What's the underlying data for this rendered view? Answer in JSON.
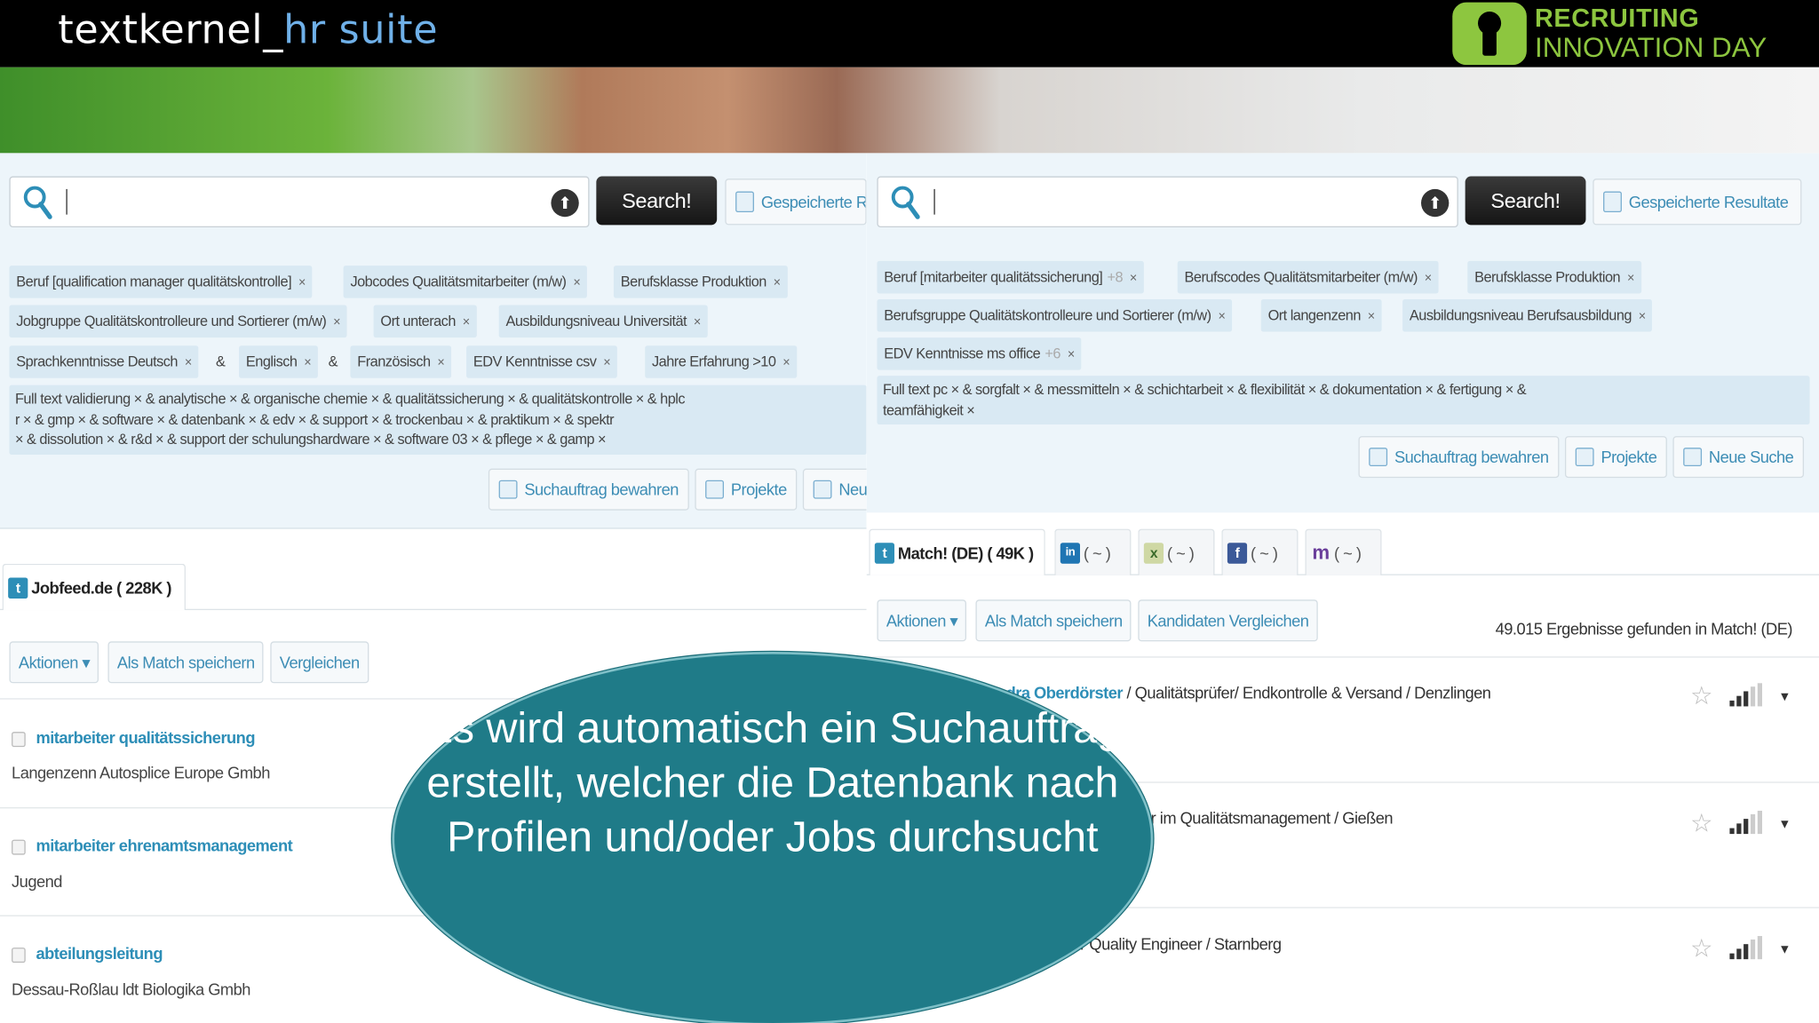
{
  "header": {
    "brand_main": "textkernel_",
    "brand_accent": "hr suite",
    "logo_line1": "RECRUITING",
    "logo_line2": "INNOVATION DAY"
  },
  "left": {
    "search_button": "Search!",
    "saved_button": "Gespeicherte R",
    "tags": [
      {
        "label": "Beruf  [qualification manager qualitätskontrolle]"
      },
      {
        "label": "Jobcodes  Qualitätsmitarbeiter (m/w)"
      },
      {
        "label": "Berufsklasse  Produktion"
      },
      {
        "label": "Jobgruppe  Qualitätskontrolleure und Sortierer (m/w)"
      },
      {
        "label": "Ort  unterach"
      },
      {
        "label": "Ausbildungsniveau  Universität"
      },
      {
        "label": "Sprachkenntnisse  Deutsch"
      },
      {
        "label": "Englisch"
      },
      {
        "label": "Französisch"
      },
      {
        "label": "EDV Kenntnisse  csv"
      },
      {
        "label": "Jahre Erfahrung  >10"
      }
    ],
    "amp": "&",
    "fulltext_line1": "Full text  validierung ×  &  analytische ×  &  organische chemie ×  &  qualitätssicherung ×  &  qualitätskontrolle ×  &  hplc",
    "fulltext_line2": "r ×  &  gmp ×  &  software ×  &  datenbank ×  &  edv ×  &  support ×  &  trockenbau ×  &  praktikum ×  &  spektr",
    "fulltext_line3": "× &  dissolution ×  &  r&d ×  &  support der schulungshardware ×  &  software 03 ×  &  pflege ×  &  gamp ×",
    "actions": [
      "Suchauftrag bewahren",
      "Projekte",
      "Neu"
    ],
    "tab": "Jobfeed.de ( 228K )",
    "toolbar": [
      "Aktionen ▾",
      "Als Match speichern",
      "Vergleichen"
    ],
    "results": [
      {
        "title": "mitarbeiter qualitätssicherung",
        "sub": "Langenzenn Autosplice Europe Gmbh"
      },
      {
        "title": "mitarbeiter ehrenamtsmanagement",
        "sub": "Jugend"
      },
      {
        "title": "abteilungsleitung",
        "sub": "Dessau-Roßlau ldt Biologika Gmbh"
      }
    ]
  },
  "right": {
    "search_button": "Search!",
    "saved_button": "Gespeicherte Resultate",
    "tags": [
      {
        "label": "Beruf  [mitarbeiter qualitätssicherung]",
        "extra": "+8"
      },
      {
        "label": "Berufscodes  Qualitätsmitarbeiter (m/w)"
      },
      {
        "label": "Berufsklasse  Produktion"
      },
      {
        "label": "Berufsgruppe  Qualitätskontrolleure und Sortierer (m/w)"
      },
      {
        "label": "Ort  langenzenn"
      },
      {
        "label": "Ausbildungsniveau  Berufsausbildung"
      },
      {
        "label": "EDV Kenntnisse  ms office",
        "extra": "+6"
      }
    ],
    "fulltext_line1": "Full text  pc ×  &  sorgfalt ×  &  messmitteln ×  &  schichtarbeit ×  &  flexibilität ×  &  dokumentation ×  &  fertigung ×  &",
    "fulltext_line2": "teamfähigkeit ×",
    "actions": [
      "Suchauftrag bewahren",
      "Projekte",
      "Neue Suche"
    ],
    "tabs": [
      "Match! (DE) ( 49K )",
      "( ~ )",
      "( ~ )",
      "( ~ )",
      "( ~ )"
    ],
    "tab_icons": [
      "t",
      "in",
      "x",
      "f",
      "m"
    ],
    "toolbar": [
      "Aktionen ▾",
      "Als Match speichern",
      "Kandidaten Vergleichen"
    ],
    "results_count": "49.015 Ergebnisse gefunden in Match! (DE)",
    "results": [
      {
        "name": "ndra Oberdörster",
        "rest": " / Qualitätsprüfer/ Endkontrolle & Versand  / Denzlingen"
      },
      {
        "name": "",
        "rest": "r im Qualitätsmanagement  / Gießen"
      },
      {
        "name": "",
        "rest": "/ Quality Engineer  / Starnberg"
      }
    ]
  },
  "callout": {
    "text": "Es wird automatisch ein Suchauftrag erstellt, welcher die Datenbank nach Profilen und/oder Jobs durchsucht"
  },
  "colors": {
    "accent_blue": "#2d8eb7",
    "logo_green": "#8dc63f",
    "callout_teal": "#1f7b88",
    "filter_bg": "#edf5fa"
  }
}
